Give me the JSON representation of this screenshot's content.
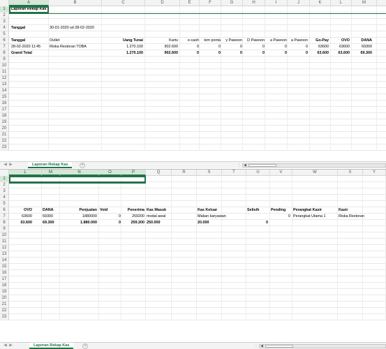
{
  "top_pane": {
    "columns": [
      "A",
      "B",
      "C",
      "D",
      "E",
      "F",
      "G",
      "H",
      "I",
      "J",
      "K",
      "L",
      "M"
    ],
    "rows": [
      "1",
      "2",
      "3",
      "4",
      "5",
      "6",
      "7",
      "8",
      "9",
      "10",
      "11",
      "12",
      "13",
      "14",
      "15",
      "16",
      "17",
      "18",
      "19",
      "20",
      "21",
      "22",
      "23"
    ],
    "title": "Laporan Rekap Kas",
    "tanggal_label": "Tanggal",
    "tanggal_value": "30-01-2020 sd 28-02-2020",
    "headers": {
      "tanggal": "Tanggal",
      "outlet": "Outlet",
      "uang_tunai": "Uang Tunai",
      "kartu": "Kartu",
      "e_cash": "e-cash",
      "item_ponta": "lem ponta",
      "pawoon1": "y Pawoon",
      "pawoon2": "D Pawoon",
      "pawoon3": "a Pawoon",
      "pawoon4": "a Pawoon",
      "gopay": "Go-Pay",
      "ovo": "OVO",
      "dana": "DANA"
    },
    "row6": {
      "tanggal": "28-02-2020 11:45",
      "outlet": "Riska Restoran TOBA",
      "uang_tunai": "1.270.100",
      "kartu": "902.600",
      "e_cash": "0",
      "item_ponta": "0",
      "pawoon1": "0",
      "pawoon2": "0",
      "pawoon3": "0",
      "pawoon4": "0",
      "gopay": "63600",
      "ovo": "63600",
      "dana": "69300"
    },
    "row7": {
      "label": "Grand Total",
      "uang_tunai": "1.270.100",
      "kartu": "902.600",
      "e_cash": "0",
      "item_ponta": "0",
      "pawoon1": "0",
      "pawoon2": "0",
      "pawoon3": "0",
      "pawoon4": "0",
      "gopay": "63.600",
      "ovo": "63.600",
      "dana": "69.300"
    },
    "sheet_tab": "Laporan Rekap Kas",
    "add_sheet": "+",
    "ellipsis": "⋮",
    "nav_prev": "◀",
    "nav_next": "▶"
  },
  "bottom_pane": {
    "columns": [
      "L",
      "M",
      "N",
      "O",
      "P",
      "Q",
      "R",
      "S",
      "T",
      "U",
      "V",
      "W",
      "X",
      "Y"
    ],
    "rows": [
      "1",
      "2",
      "3",
      "4",
      "5",
      "6",
      "7",
      "8",
      "9",
      "10",
      "11",
      "12",
      "13",
      "14",
      "15",
      "16",
      "17",
      "18",
      "19",
      "20",
      "21",
      "22",
      "23"
    ],
    "headers": {
      "ovo": "OVO",
      "dana": "DANA",
      "penjualan": "Penjualan",
      "void": "Void",
      "penerimaan": "Penerima",
      "kas_masuk": "Kas Masuk",
      "kas_keluar": "Kas Keluar",
      "selisih": "Selisih",
      "pending": "Pending",
      "perangkat_kasir": "Perangkat Kasir",
      "kasir": "Kasir"
    },
    "row6": {
      "ovo": "63600",
      "dana": "69300",
      "penjualan": "1880000",
      "void": "0",
      "penerimaan": "259200",
      "kas_masuk": "modal awal",
      "kas_keluar": "Makan karyawan",
      "pending": "0",
      "perangkat_kasir": "Perangkat Utama 1",
      "kasir": "Riska Restoran"
    },
    "row7": {
      "ovo": "63.600",
      "dana": "69.300",
      "penjualan": "1.880.000",
      "void": "0",
      "penerimaan": "259.200",
      "kas_masuk": "250.000",
      "kas_keluar": "20.000",
      "selisih": "0"
    },
    "sheet_tab": "Laporan Rekap Kas",
    "add_sheet": "+",
    "ellipsis": "⋮",
    "nav_prev": "◀",
    "nav_next": "▶"
  },
  "colors": {
    "accent": "#217346",
    "header_bg": "#f3f3f3",
    "selected_header": "#d6e6d9"
  }
}
